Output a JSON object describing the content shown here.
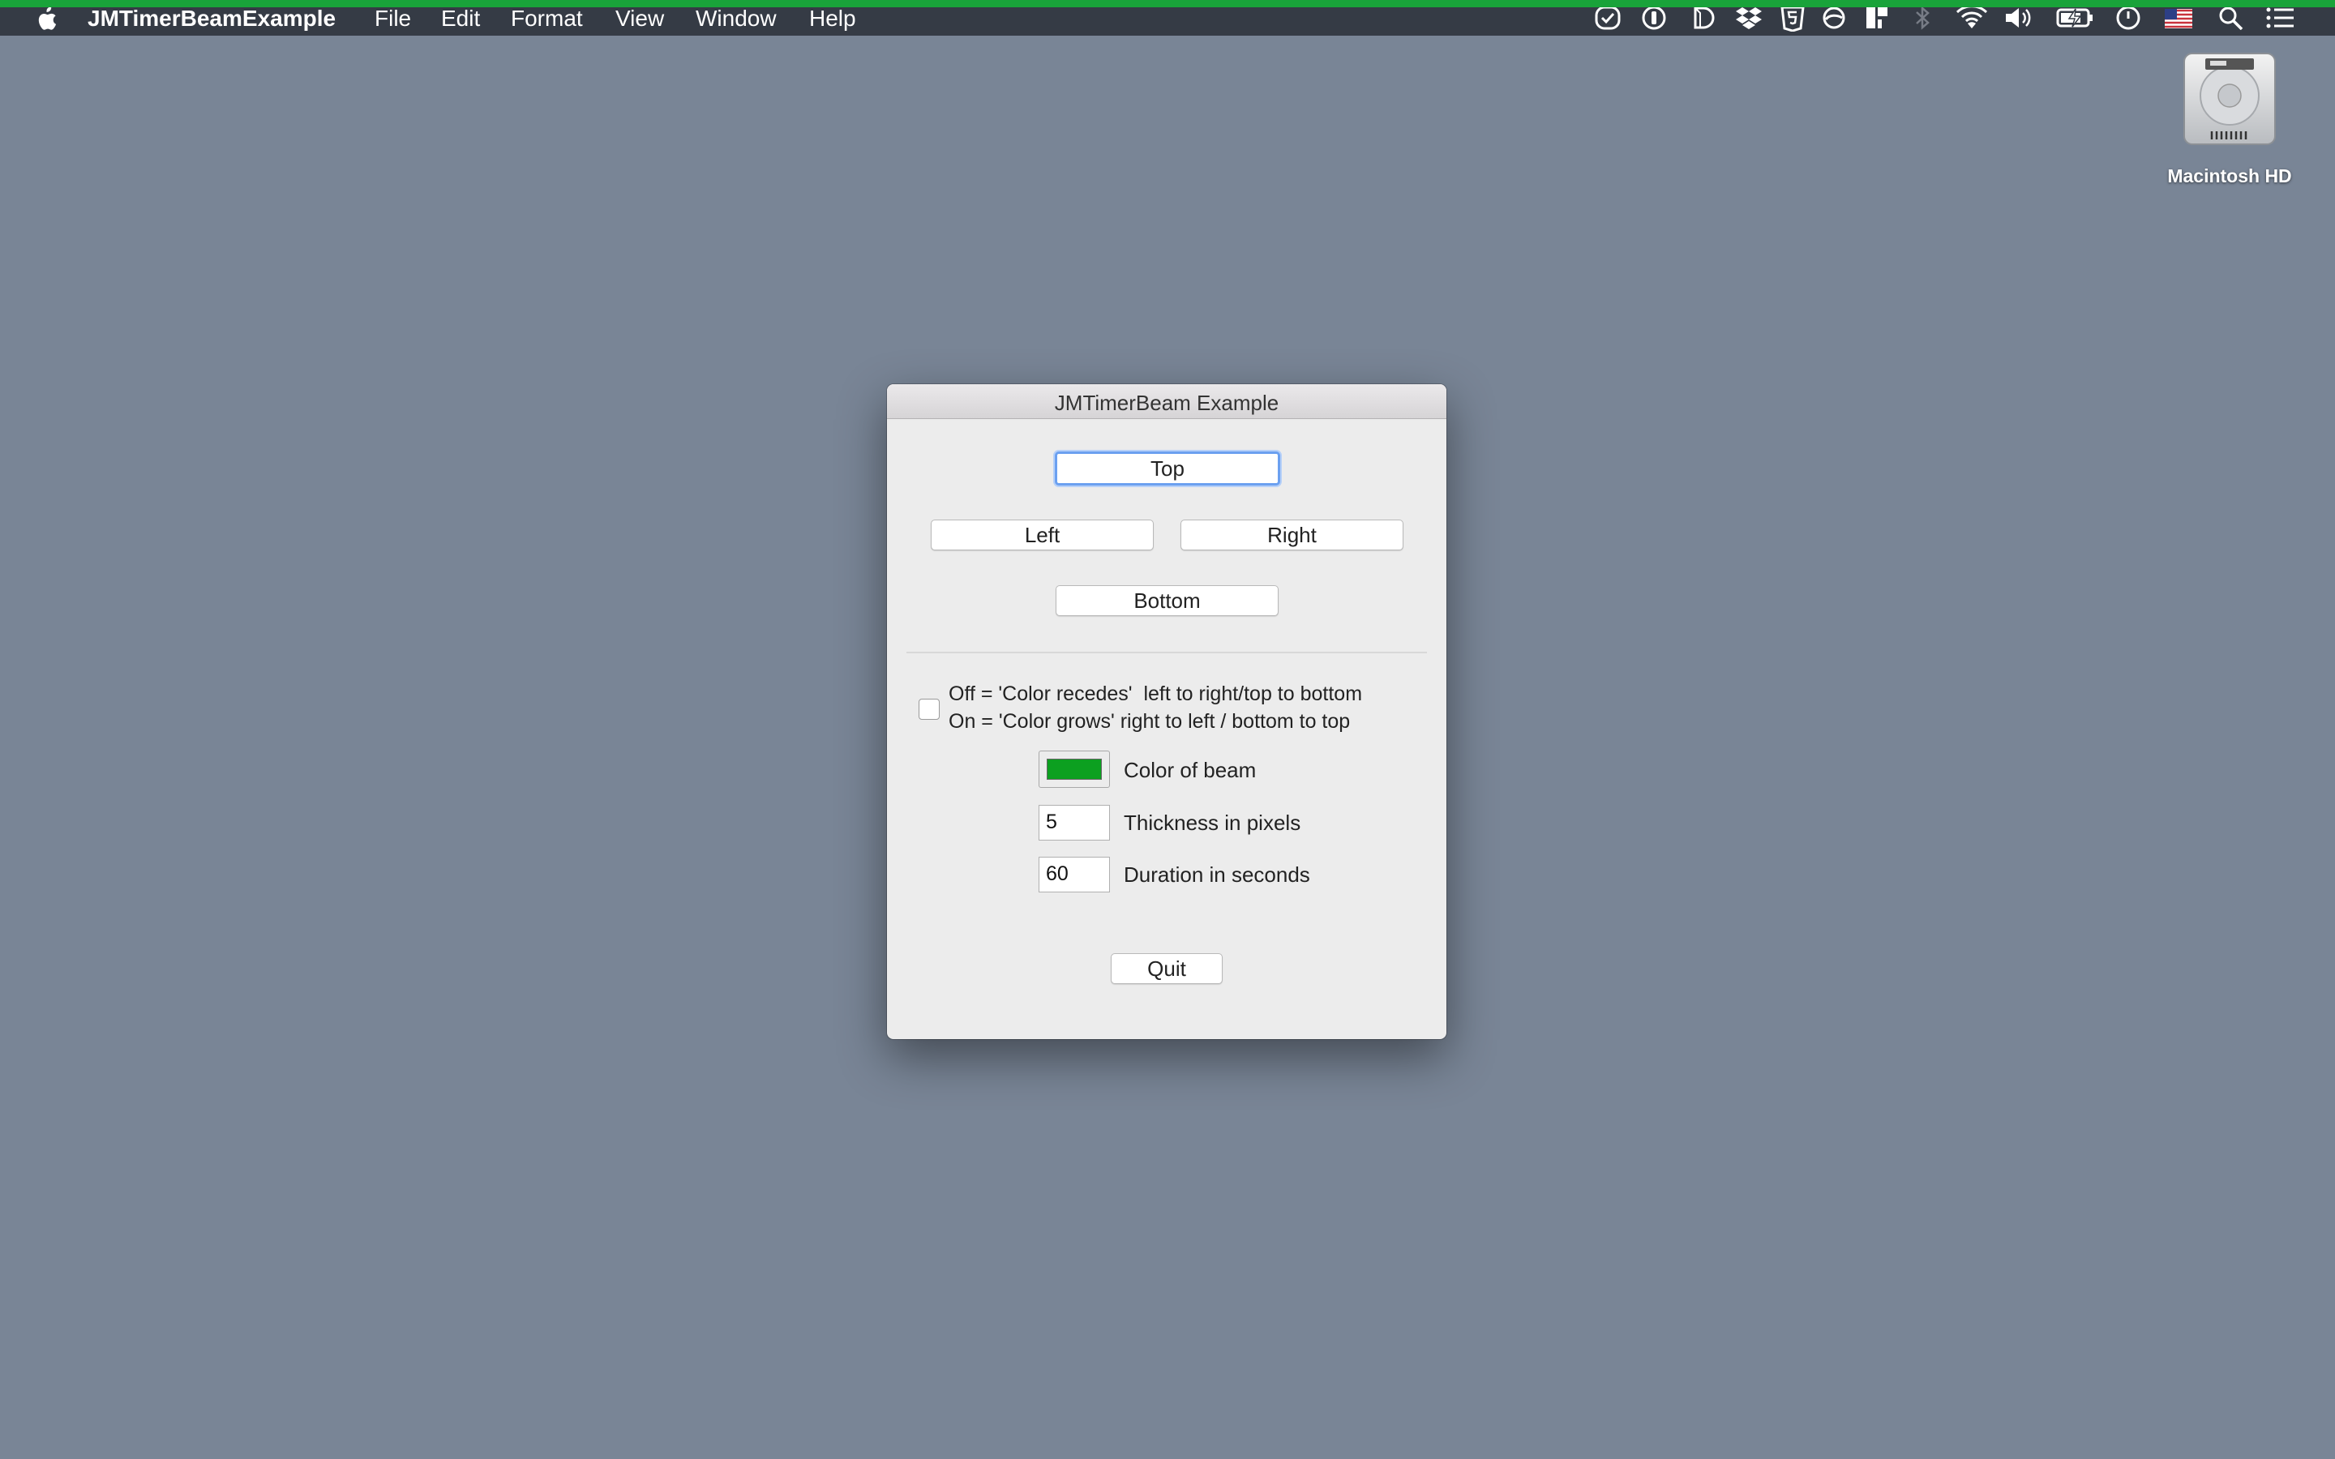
{
  "menubar": {
    "app_name": "JMTimerBeamExample",
    "menus": [
      "File",
      "Edit",
      "Format",
      "View",
      "Window",
      "Help"
    ],
    "status_icons": [
      "task-check-icon",
      "onepassword-icon",
      "d-app-icon",
      "dropbox-icon",
      "html5-icon",
      "sync-icon",
      "layout-icon",
      "bluetooth-icon",
      "wifi-icon",
      "volume-icon",
      "battery-charging-icon",
      "clock-icon",
      "us-flag-icon",
      "spotlight-search-icon",
      "notification-center-icon"
    ],
    "beam_color": "#19a33a"
  },
  "desktop": {
    "drive_label": "Macintosh HD"
  },
  "window": {
    "title": "JMTimerBeam Example",
    "buttons": {
      "top": "Top",
      "left": "Left",
      "right": "Right",
      "bottom": "Bottom",
      "quit": "Quit"
    },
    "direction": {
      "checked": false,
      "off_text": "Off = 'Color recedes'  left to right/top to bottom",
      "on_text": "On = 'Color grows' right to left / bottom to top"
    },
    "color": {
      "value": "#0ca020",
      "label": "Color of beam"
    },
    "thickness": {
      "value": "5",
      "label": "Thickness in pixels"
    },
    "duration": {
      "value": "60",
      "label": "Duration in seconds"
    }
  }
}
